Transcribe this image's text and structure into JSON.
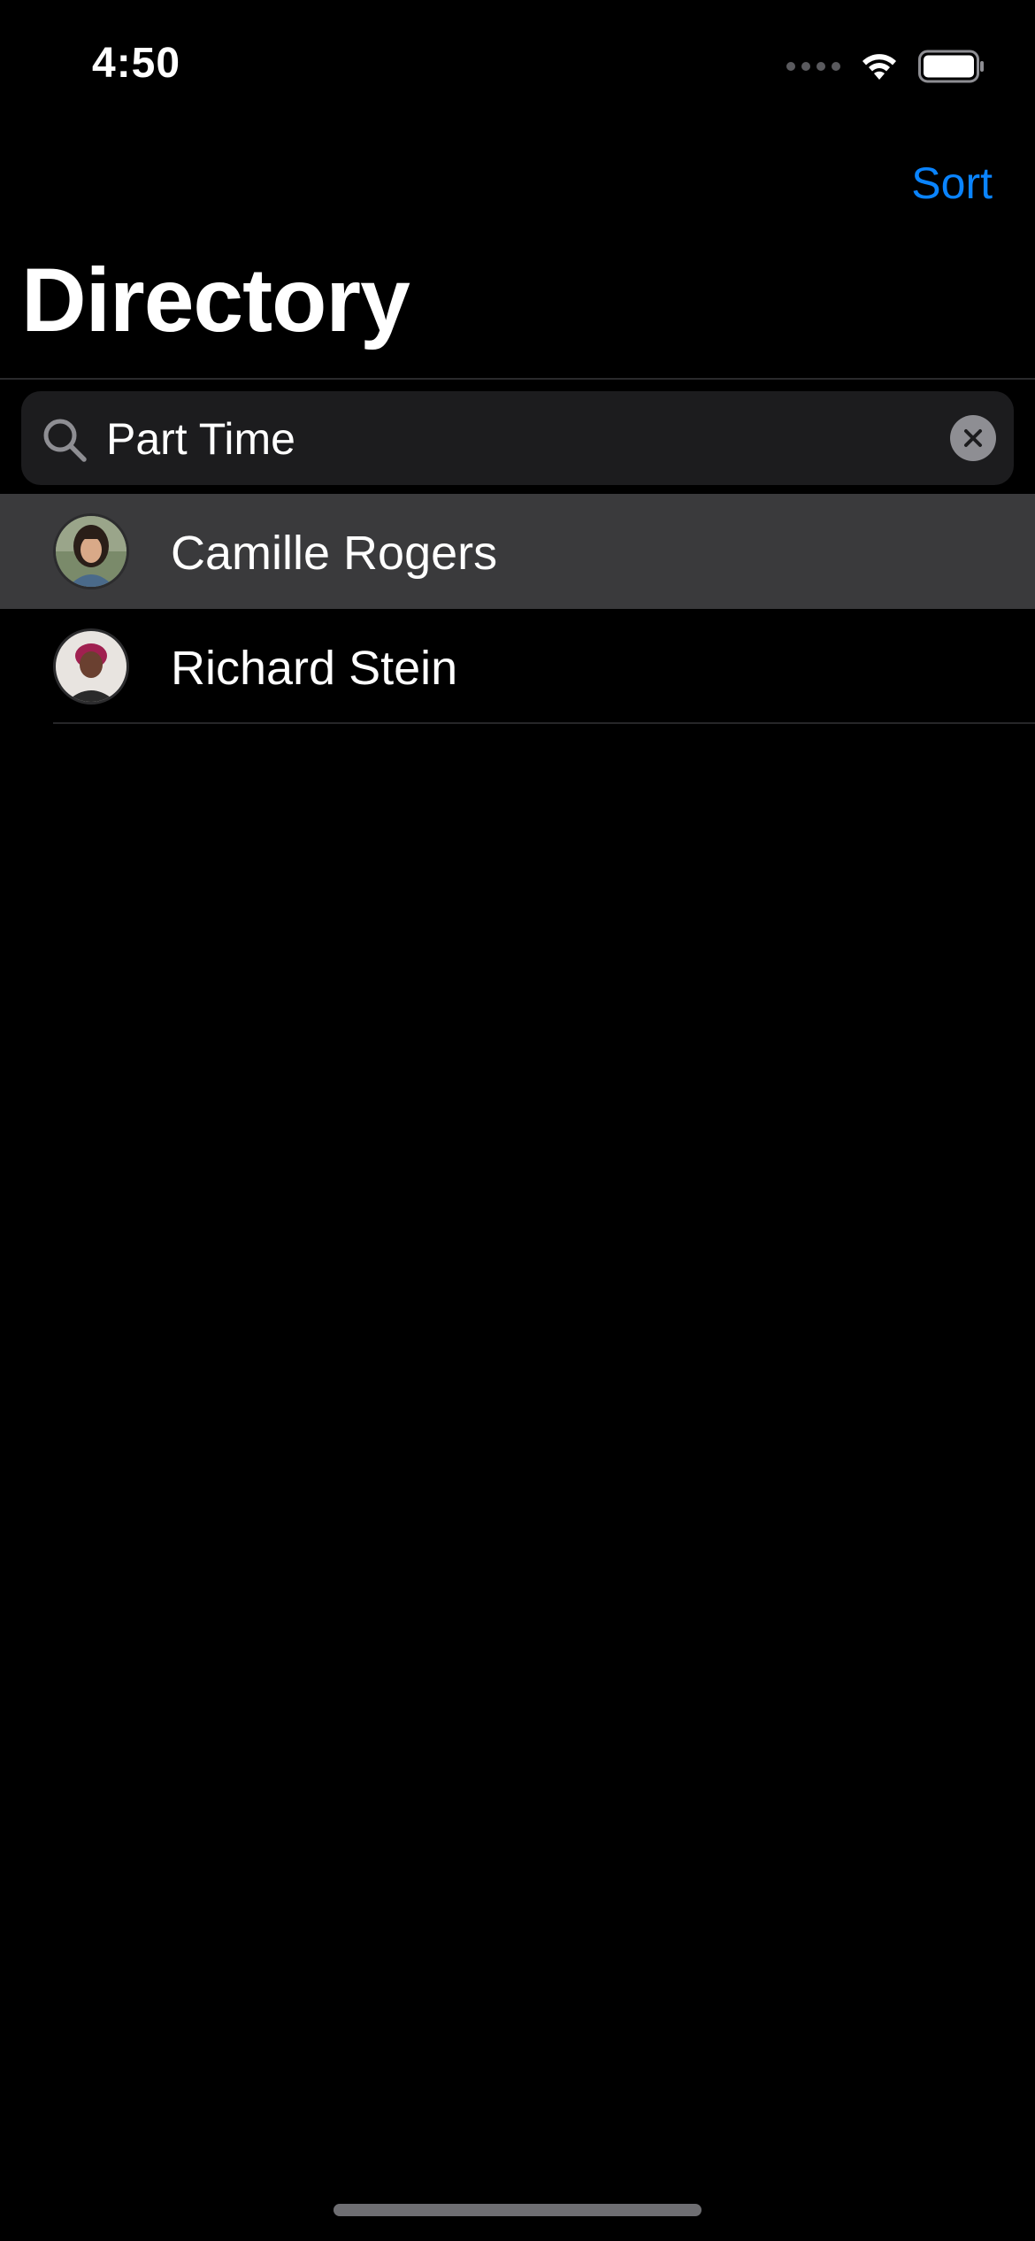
{
  "status_bar": {
    "time": "4:50",
    "icons": [
      "cellular-signal-icon",
      "wifi-icon",
      "battery-icon"
    ]
  },
  "nav": {
    "sort_label": "Sort",
    "title": "Directory"
  },
  "search": {
    "value": "Part Time",
    "icon": "search-icon",
    "clear_icon": "clear-icon"
  },
  "results": [
    {
      "name": "Camille Rogers",
      "selected": true
    },
    {
      "name": "Richard Stein",
      "selected": false
    }
  ],
  "colors": {
    "background": "#000000",
    "accent": "#0a84ff",
    "search_field": "#1c1c1e",
    "selected_row": "#3a3a3c"
  }
}
